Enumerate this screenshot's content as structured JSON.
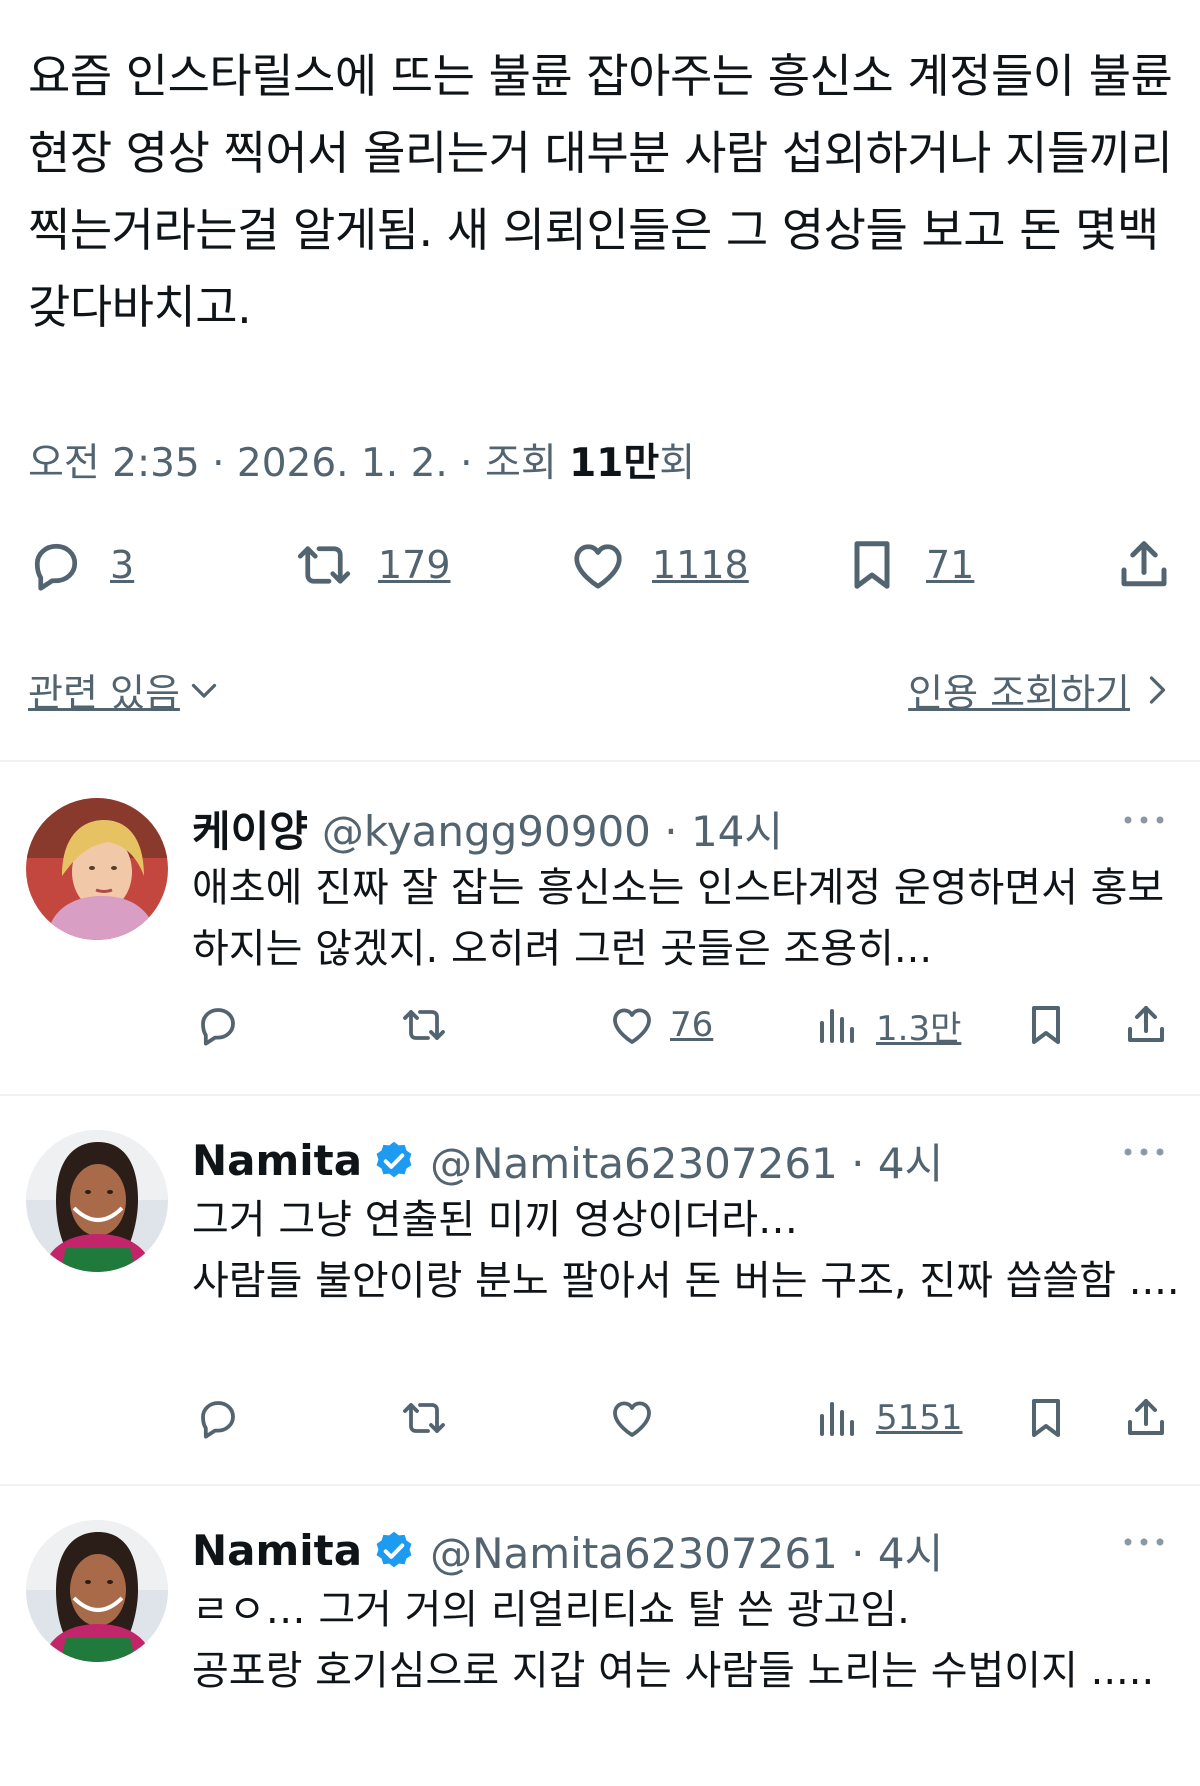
{
  "tweet": {
    "text": "요즘 인스타릴스에 뜨는 불륜 잡아주는 흥신소 계정들이 불륜현장 영상 찍어서 올리는거 대부분 사람 섭외하거나 지들끼리 찍는거라는걸 알게됨. 새 의뢰인들은 그 영상들 보고 돈 몇백 갖다바치고.",
    "meta_prefix": "오전 2:35 · 2026. 1. 2. · 조회 ",
    "views_count": "11만",
    "views_suffix": "회",
    "replies": "3",
    "retweets": "179",
    "likes": "1118",
    "bookmarks": "71"
  },
  "related": {
    "label": "관련 있음"
  },
  "quote_views": {
    "label": "인용 조회하기"
  },
  "replies": [
    {
      "name": "케이양",
      "handle": "@kyangg90900 · 14시",
      "verified": false,
      "text": "애초에 진짜 잘 잡는 흥신소는 인스타계정 운영하면서 홍보하지는 않겠지. 오히려 그런 곳들은 조용히...",
      "likes": "76",
      "views": "1.3만"
    },
    {
      "name": "Namita",
      "handle": "@Namita62307261 · 4시",
      "verified": true,
      "text": "그거 그냥 연출된 미끼 영상이더라…\n사람들 불안이랑 분노 팔아서 돈 버는 구조, 진짜 씁쓸함 ....",
      "likes": "",
      "views": "5151"
    },
    {
      "name": "Namita",
      "handle": "@Namita62307261 · 4시",
      "verified": true,
      "text": "ㄹㅇ… 그거 거의 리얼리티쇼 탈 쓴 광고임.\n공포랑 호기심으로 지갑 여는 사람들 노리는 수법이지 .....",
      "likes": "",
      "views": ""
    }
  ],
  "colors": {
    "text": "#0f1419",
    "muted": "#536471",
    "verified": "#1d9bf0",
    "divider": "#eff3f4"
  }
}
